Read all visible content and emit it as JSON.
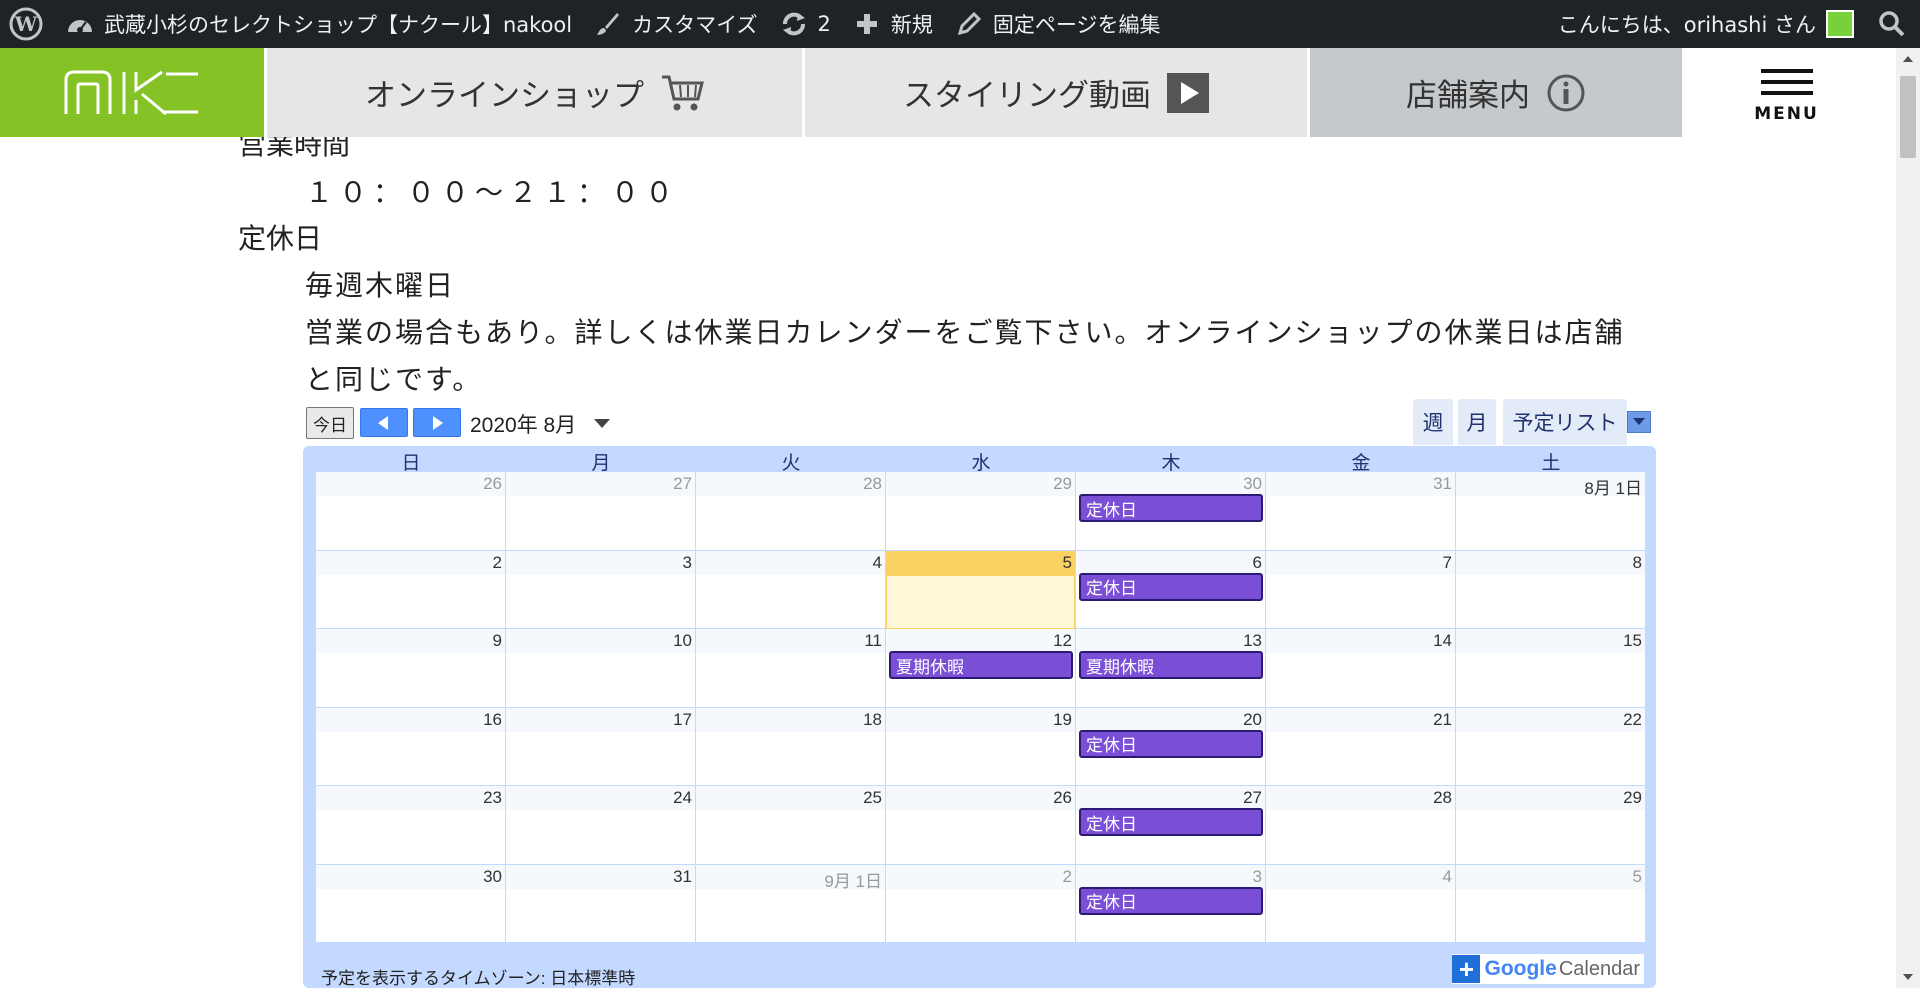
{
  "admin_bar": {
    "site_name": "武蔵小杉のセレクトショップ【ナクール】nakool",
    "customize": "カスタマイズ",
    "updates_count": "2",
    "new": "新規",
    "edit_page": "固定ページを編集",
    "greeting": "こんにちは、orihashi さん"
  },
  "site_nav": {
    "logo_text": "nk",
    "tabs": [
      {
        "label": "オンラインショップ",
        "icon": "cart-icon"
      },
      {
        "label": "スタイリング動画",
        "icon": "play-icon"
      },
      {
        "label": "店舗案内",
        "icon": "info-icon"
      }
    ],
    "menu_label": "MENU"
  },
  "content": {
    "hours_heading": "営業時間",
    "hours_value": "１０：００～２１：００",
    "closed_heading": "定休日",
    "closed_value": "毎週木曜日",
    "note_line1": "営業の場合もあり。詳しくは休業日カレンダーをご覧下さい。オンラインショップの休業日は店舗",
    "note_line2": "と同じです。"
  },
  "calendar": {
    "today_label": "今日",
    "month_label": "2020年 8月",
    "view_week": "週",
    "view_month": "月",
    "view_agenda": "予定リスト",
    "weekdays": [
      "日",
      "月",
      "火",
      "水",
      "木",
      "金",
      "土"
    ],
    "weeks": [
      [
        "26",
        "27",
        "28",
        "29",
        "30",
        "31",
        "8月 1日"
      ],
      [
        "2",
        "3",
        "4",
        "5",
        "6",
        "7",
        "8"
      ],
      [
        "9",
        "10",
        "11",
        "12",
        "13",
        "14",
        "15"
      ],
      [
        "16",
        "17",
        "18",
        "19",
        "20",
        "21",
        "22"
      ],
      [
        "23",
        "24",
        "25",
        "26",
        "27",
        "28",
        "29"
      ],
      [
        "30",
        "31",
        "9月 1日",
        "2",
        "3",
        "4",
        "5"
      ]
    ],
    "other_month": [
      [
        0,
        0
      ],
      [
        0,
        1
      ],
      [
        0,
        2
      ],
      [
        0,
        3
      ],
      [
        0,
        4
      ],
      [
        0,
        5
      ],
      [
        5,
        2
      ],
      [
        5,
        3
      ],
      [
        5,
        4
      ],
      [
        5,
        5
      ],
      [
        5,
        6
      ]
    ],
    "today": [
      1,
      3
    ],
    "events": [
      {
        "week": 0,
        "day": 4,
        "title": "定休日"
      },
      {
        "week": 1,
        "day": 4,
        "title": "定休日"
      },
      {
        "week": 2,
        "day": 3,
        "title": "夏期休暇"
      },
      {
        "week": 2,
        "day": 4,
        "title": "夏期休暇"
      },
      {
        "week": 3,
        "day": 4,
        "title": "定休日"
      },
      {
        "week": 4,
        "day": 4,
        "title": "定休日"
      },
      {
        "week": 5,
        "day": 4,
        "title": "定休日"
      }
    ],
    "timezone_note": "予定を表示するタイムゾーン: 日本標準時",
    "badge_google": "Google",
    "badge_calendar": "Calendar",
    "colors": {
      "event": "#7a4fd6",
      "today": "#fad163",
      "border": "#c3d9ff"
    }
  }
}
